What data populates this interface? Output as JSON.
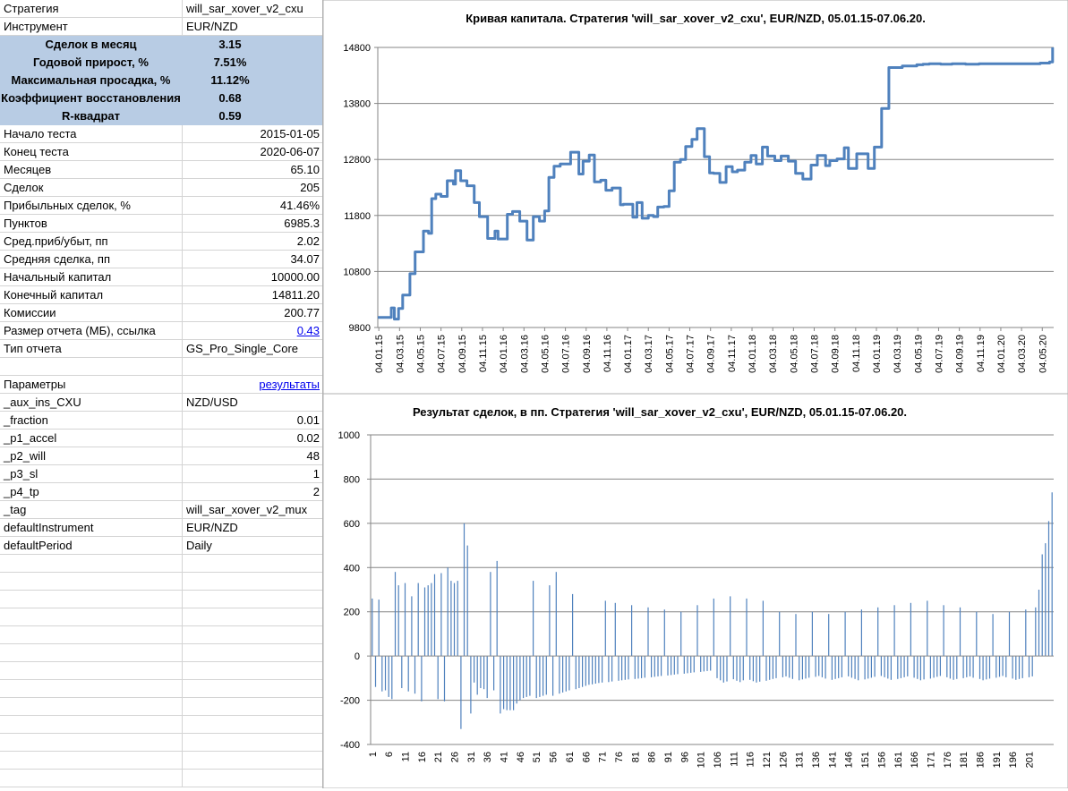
{
  "sheet": {
    "rows": [
      {
        "label": "Стратегия",
        "value": "will_sar_xover_v2_cxu",
        "align": "left"
      },
      {
        "label": "Инструмент",
        "value": "EUR/NZD",
        "align": "left"
      },
      {
        "label": "Сделок в месяц",
        "value": "3.15",
        "highlight": true
      },
      {
        "label": "Годовой прирост, %",
        "value": "7.51%",
        "highlight": true
      },
      {
        "label": "Максимальная просадка, %",
        "value": "11.12%",
        "highlight": true
      },
      {
        "label": "Коэффициент восстановления",
        "value": "0.68",
        "highlight": true
      },
      {
        "label": "R-квадрат",
        "value": "0.59",
        "highlight": true
      },
      {
        "label": "Начало теста",
        "value": "2015-01-05",
        "align": "right"
      },
      {
        "label": "Конец теста",
        "value": "2020-06-07",
        "align": "right"
      },
      {
        "label": "Месяцев",
        "value": "65.10",
        "align": "right"
      },
      {
        "label": "Сделок",
        "value": "205",
        "align": "right"
      },
      {
        "label": "Прибыльных сделок, %",
        "value": "41.46%",
        "align": "right"
      },
      {
        "label": "Пунктов",
        "value": "6985.3",
        "align": "right"
      },
      {
        "label": "Сред.приб/убыт, пп",
        "value": "2.02",
        "align": "right"
      },
      {
        "label": "Средняя сделка, пп",
        "value": "34.07",
        "align": "right"
      },
      {
        "label": "Начальный капитал",
        "value": "10000.00",
        "align": "right"
      },
      {
        "label": "Конечный капитал",
        "value": "14811.20",
        "align": "right"
      },
      {
        "label": "Комиссии",
        "value": "200.77",
        "align": "right"
      },
      {
        "label": "Размер отчета (МБ), ссылка",
        "value": "0.43",
        "align": "right",
        "link": true
      },
      {
        "label": "Тип отчета",
        "value": "GS_Pro_Single_Core",
        "align": "left"
      },
      {
        "label": "",
        "value": "",
        "align": "left"
      },
      {
        "label": "Параметры",
        "value": "результаты",
        "align": "right",
        "link": true
      },
      {
        "label": "_aux_ins_CXU",
        "value": "NZD/USD",
        "align": "left"
      },
      {
        "label": "_fraction",
        "value": "0.01",
        "align": "right"
      },
      {
        "label": "_p1_accel",
        "value": "0.02",
        "align": "right"
      },
      {
        "label": "_p2_will",
        "value": "48",
        "align": "right"
      },
      {
        "label": "_p3_sl",
        "value": "1",
        "align": "right"
      },
      {
        "label": "_p4_tp",
        "value": "2",
        "align": "right"
      },
      {
        "label": "_tag",
        "value": "will_sar_xover_v2_mux",
        "align": "left"
      },
      {
        "label": "defaultInstrument",
        "value": "EUR/NZD",
        "align": "left"
      },
      {
        "label": "defaultPeriod",
        "value": "Daily",
        "align": "left"
      },
      {
        "label": "",
        "value": ""
      },
      {
        "label": "",
        "value": ""
      },
      {
        "label": "",
        "value": ""
      },
      {
        "label": "",
        "value": ""
      },
      {
        "label": "",
        "value": ""
      },
      {
        "label": "",
        "value": ""
      },
      {
        "label": "",
        "value": ""
      },
      {
        "label": "",
        "value": ""
      },
      {
        "label": "",
        "value": ""
      },
      {
        "label": "",
        "value": ""
      },
      {
        "label": "",
        "value": ""
      },
      {
        "label": "",
        "value": ""
      },
      {
        "label": "",
        "value": ""
      }
    ]
  },
  "colors": {
    "series": "#4f81bd",
    "highlight": "#b8cce4",
    "grid": "#868686"
  },
  "chart_data": [
    {
      "type": "line",
      "title": "Кривая капитала. Стратегия 'will_sar_xover_v2_cxu', EUR/NZD, 05.01.15-07.06.20.",
      "xlabel": "",
      "ylabel": "",
      "ylim": [
        9800,
        14800
      ],
      "yticks": [
        9800,
        10800,
        11800,
        12800,
        13800,
        14800
      ],
      "grid": true,
      "x_tick_labels": [
        "04.01.15",
        "04.03.15",
        "04.05.15",
        "04.07.15",
        "04.09.15",
        "04.11.15",
        "04.01.16",
        "04.03.16",
        "04.05.16",
        "04.07.16",
        "04.09.16",
        "04.11.16",
        "04.01.17",
        "04.03.17",
        "04.05.17",
        "04.07.17",
        "04.09.17",
        "04.11.17",
        "04.01.18",
        "04.03.18",
        "04.05.18",
        "04.07.18",
        "04.09.18",
        "04.11.18",
        "04.01.19",
        "04.03.19",
        "04.05.19",
        "04.07.19",
        "04.09.19",
        "04.11.19",
        "04.01.20",
        "04.03.20",
        "04.05.20"
      ],
      "x_months": [
        0,
        1.3,
        1.6,
        2,
        2.4,
        3.1,
        3.6,
        4.4,
        4.9,
        5.2,
        5.6,
        6.1,
        6.7,
        7.3,
        7.5,
        8,
        8.6,
        9.3,
        9.8,
        10.6,
        11.3,
        11.6,
        12.5,
        13,
        13.7,
        14.4,
        15,
        15.6,
        16.1,
        16.5,
        17,
        17.6,
        18.6,
        19.4,
        19.8,
        20.4,
        20.9,
        21.5,
        22,
        22.6,
        23.4,
        23.7,
        24.6,
        25,
        25.5,
        26.1,
        26.6,
        27,
        27.6,
        28.1,
        28.6,
        29.2,
        29.7,
        30.3,
        30.8,
        31.5,
        32,
        32.4,
        33,
        33.6,
        34.2,
        34.7,
        35.4,
        36,
        36.5,
        37.1,
        37.6,
        38.3,
        38.9,
        39.6,
        40.3,
        41,
        41.8,
        42.4,
        43.2,
        43.6,
        44.3,
        45,
        45.4,
        46.2,
        46.8,
        47.3,
        47.9,
        48.6,
        49.3,
        50,
        50.6,
        51.4,
        52,
        52.6,
        53.2,
        53.8,
        54.3,
        55,
        55.4,
        56.1,
        56.7,
        57.3,
        58,
        58.6,
        59.2,
        59.7,
        60.3,
        60.8,
        61.4,
        62,
        62.5,
        63,
        63.9,
        64.8,
        65.1
      ],
      "y": [
        9980,
        10150,
        9950,
        10140,
        10380,
        10760,
        11150,
        11520,
        11480,
        12100,
        12180,
        12140,
        12420,
        12360,
        12600,
        12420,
        12330,
        12030,
        11780,
        11390,
        11520,
        11380,
        11820,
        11870,
        11700,
        11360,
        11780,
        11700,
        11880,
        12480,
        12680,
        12720,
        12930,
        12540,
        12770,
        12880,
        12400,
        12430,
        12250,
        12290,
        11990,
        12000,
        11770,
        12030,
        11750,
        11800,
        11780,
        11950,
        11960,
        12240,
        12750,
        12800,
        13030,
        13160,
        13350,
        12850,
        12560,
        12550,
        12390,
        12670,
        12580,
        12610,
        12750,
        12870,
        12720,
        13020,
        12860,
        12780,
        12860,
        12770,
        12550,
        12450,
        12700,
        12870,
        12690,
        12780,
        12810,
        13010,
        12640,
        12900,
        12900,
        12640,
        13020,
        13710,
        14440,
        14440,
        14470,
        14470,
        14490,
        14500,
        14510,
        14510,
        14500,
        14500,
        14510,
        14510,
        14500,
        14500,
        14510,
        14510,
        14510,
        14510,
        14510,
        14510,
        14510,
        14510,
        14510,
        14510,
        14520,
        14540,
        14800
      ]
    },
    {
      "type": "bar",
      "title": "Результат сделок, в пп. Стратегия 'will_sar_xover_v2_cxu', EUR/NZD, 05.01.15-07.06.20.",
      "xlabel": "",
      "ylabel": "",
      "ylim": [
        -400,
        1000
      ],
      "yticks": [
        -400,
        -200,
        0,
        200,
        400,
        600,
        800,
        1000
      ],
      "grid": true,
      "x_tick_labels": [
        "1",
        "6",
        "11",
        "16",
        "21",
        "26",
        "31",
        "36",
        "41",
        "46",
        "51",
        "56",
        "61",
        "66",
        "71",
        "76",
        "81",
        "86",
        "91",
        "96",
        "101",
        "106",
        "111",
        "116",
        "121",
        "126",
        "131",
        "136",
        "141",
        "146",
        "151",
        "156",
        "161",
        "166",
        "171",
        "176",
        "181",
        "186",
        "191",
        "196",
        "201"
      ],
      "values": [
        260,
        -140,
        255,
        -160,
        -155,
        -185,
        -195,
        380,
        320,
        -145,
        330,
        -160,
        270,
        -170,
        330,
        -205,
        310,
        320,
        330,
        370,
        -195,
        375,
        -205,
        400,
        340,
        330,
        340,
        -330,
        600,
        500,
        -260,
        -120,
        -175,
        -145,
        -150,
        -190,
        380,
        -155,
        430,
        -260,
        -240,
        -245,
        -245,
        -245,
        -215,
        -200,
        -190,
        -185,
        -180,
        340,
        -190,
        -185,
        -180,
        -175,
        320,
        -180,
        380,
        -170,
        -165,
        -160,
        -155,
        280,
        -150,
        -145,
        -140,
        -135,
        -130,
        -128,
        -125,
        -122,
        -120,
        250,
        -118,
        -115,
        240,
        -112,
        -110,
        -108,
        -106,
        230,
        -104,
        -102,
        -100,
        -98,
        220,
        -96,
        -94,
        -92,
        -90,
        210,
        -88,
        -86,
        -84,
        -82,
        200,
        -80,
        -78,
        -76,
        -74,
        230,
        -72,
        -70,
        -68,
        -66,
        260,
        -100,
        -110,
        -120,
        -115,
        270,
        -105,
        -112,
        -118,
        -110,
        260,
        -108,
        -114,
        -120,
        -116,
        250,
        -112,
        -108,
        -104,
        -100,
        200,
        -96,
        -92,
        -98,
        -104,
        190,
        -110,
        -106,
        -102,
        -98,
        200,
        -94,
        -90,
        -96,
        -102,
        190,
        -108,
        -104,
        -100,
        -96,
        200,
        -92,
        -98,
        -104,
        -110,
        210,
        -106,
        -102,
        -98,
        -94,
        220,
        -90,
        -96,
        -102,
        -108,
        230,
        -104,
        -100,
        -96,
        -92,
        240,
        -98,
        -104,
        -110,
        -106,
        250,
        -102,
        -98,
        -94,
        -90,
        230,
        -96,
        -102,
        -108,
        -104,
        220,
        -100,
        -96,
        -92,
        -98,
        200,
        -104,
        -110,
        -106,
        -102,
        190,
        -98,
        -94,
        -90,
        -96,
        200,
        -102,
        -108,
        -104,
        -100,
        210,
        -96,
        -92,
        220,
        300,
        460,
        510,
        610,
        740
      ]
    }
  ]
}
